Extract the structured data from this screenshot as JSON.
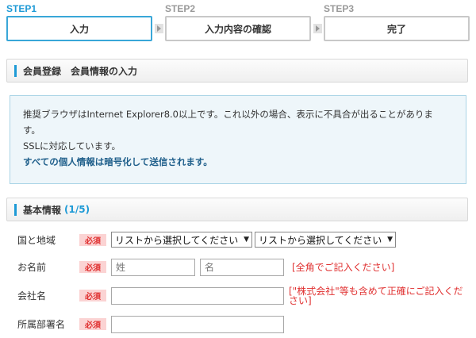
{
  "steps": [
    {
      "label": "STEP1",
      "text": "入力",
      "state": "active"
    },
    {
      "label": "STEP2",
      "text": "入力内容の確認",
      "state": "inactive"
    },
    {
      "label": "STEP3",
      "text": "完了",
      "state": "inactive"
    }
  ],
  "section1": {
    "title": "会員登録　会員情報の入力"
  },
  "info": {
    "line1": "推奨ブラウザはInternet Explorer8.0以上です。これ以外の場合、表示に不具合が出ることがありま",
    "line2": "す。",
    "line3": "SSLに対応しています。",
    "line4": "すべての個人情報は暗号化して送信されます。"
  },
  "section2": {
    "title": "基本情報",
    "count": "(1/5)"
  },
  "required_label": "必須",
  "form": {
    "country": {
      "label": "国と地域",
      "select1": "リストから選択してください",
      "select2": "リストから選択してください"
    },
    "name": {
      "label": "お名前",
      "last_placeholder": "姓",
      "first_placeholder": "名",
      "note": "[全角でご記入ください]"
    },
    "company": {
      "label": "会社名",
      "note_line1": "[\"株式会社\"等も含めて正確にご記入くだ",
      "note_line2": "さい]"
    },
    "department": {
      "label": "所属部署名"
    }
  },
  "colors": {
    "accent": "#1e9ad6",
    "required_bg": "#fbd3d3",
    "required_text": "#e03030",
    "info_bg": "#eef6fa"
  }
}
